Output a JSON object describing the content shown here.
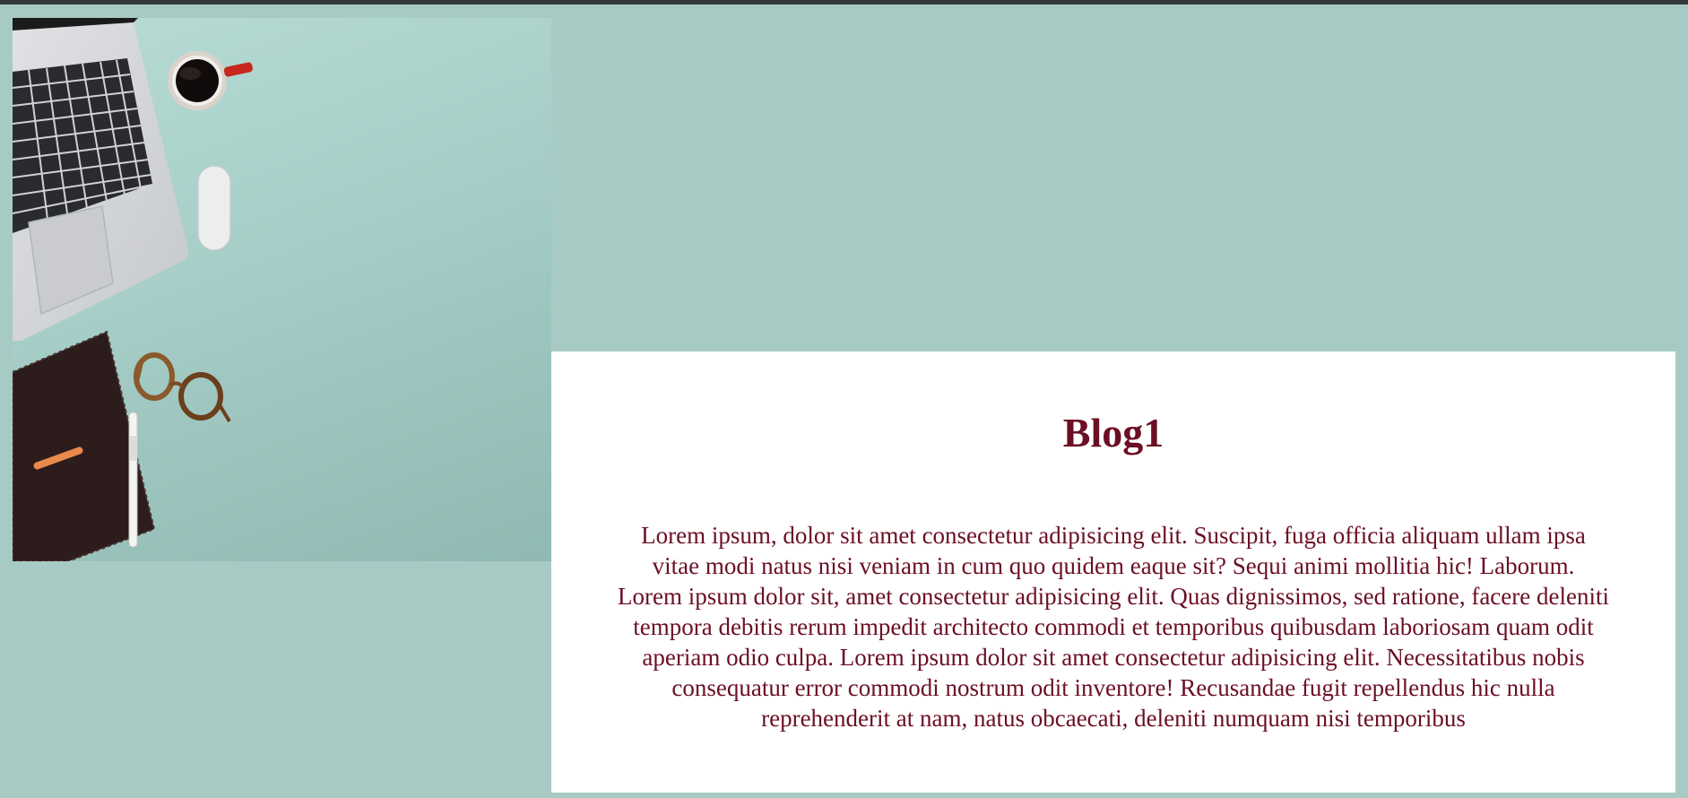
{
  "hero": {
    "alt": "Top view of a desk with laptop, coffee cup, mouse, notebook, pen and glasses"
  },
  "post": {
    "title": "Blog1",
    "body": "Lorem ipsum, dolor sit amet consectetur adipisicing elit. Suscipit, fuga officia aliquam ullam ipsa vitae modi natus nisi veniam in cum quo quidem eaque sit? Sequi animi mollitia hic! Laborum. Lorem ipsum dolor sit, amet consectetur adipisicing elit. Quas dignissimos, sed ratione, facere deleniti tempora debitis rerum impedit architecto commodi et temporibus quibusdam laboriosam quam odit aperiam odio culpa. Lorem ipsum dolor sit amet consectetur adipisicing elit. Necessitatibus nobis consequatur error commodi nostrum odit inventore! Recusandae fugit repellendus hic nulla reprehenderit at nam, natus obcaecati, deleniti numquam nisi temporibus"
  },
  "colors": {
    "background": "#a8cac5",
    "title": "#6b0f24",
    "card": "#ffffff"
  }
}
